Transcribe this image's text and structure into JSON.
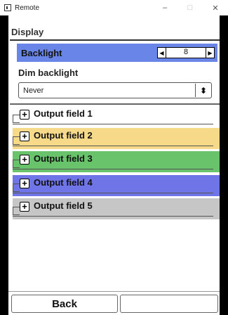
{
  "window": {
    "title": "Remote",
    "minimize": "–",
    "maximize": "□",
    "close": "✕"
  },
  "page": {
    "section_title": "Display",
    "backlight": {
      "label": "Backlight",
      "value": "8",
      "dec_icon": "◀",
      "inc_icon": "▶",
      "color": "#6a85e8"
    },
    "dim_backlight": {
      "label": "Dim backlight",
      "selected": "Never",
      "toggle_icon": "⬍"
    },
    "output_fields": [
      {
        "label": "Output field 1",
        "color": "#ffffff",
        "expand_icon": "+"
      },
      {
        "label": "Output field 2",
        "color": "#f7d98a",
        "expand_icon": "+"
      },
      {
        "label": "Output field 3",
        "color": "#69c36a",
        "expand_icon": "+"
      },
      {
        "label": "Output field 4",
        "color": "#6f74e6",
        "expand_icon": "+"
      },
      {
        "label": "Output field 5",
        "color": "#c6c6c6",
        "expand_icon": "+"
      }
    ]
  },
  "footer": {
    "back_label": "Back",
    "second_label": ""
  }
}
